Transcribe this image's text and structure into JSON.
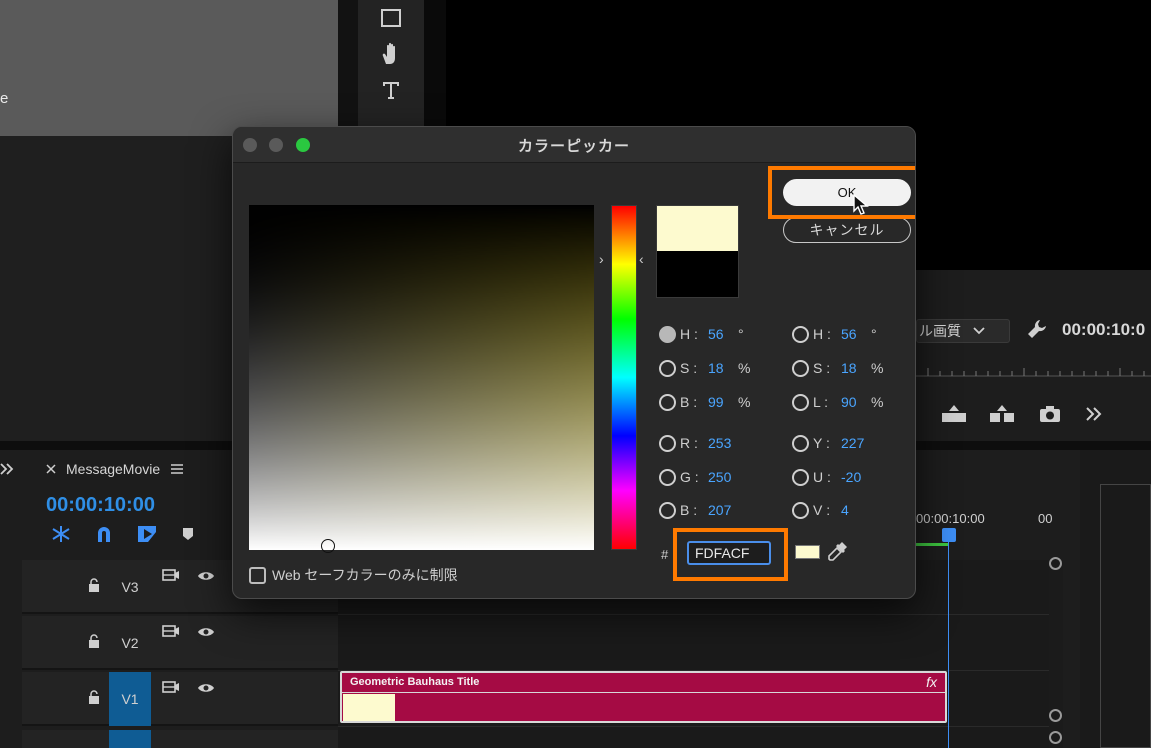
{
  "background_app": {
    "left_panel_text": "e",
    "program_monitor": {
      "quality_value": "ル画質",
      "timecode": "00:00:10:0"
    },
    "timeline": {
      "sequence_name": "MessageMovie",
      "timecode": "00:00:10:00",
      "ruler_labels": [
        "00:00:10:00",
        "00"
      ],
      "tracks": [
        {
          "name": "V3"
        },
        {
          "name": "V2"
        },
        {
          "name": "V1"
        }
      ],
      "clip": {
        "title": "Geometric Bauhaus Title",
        "fx": "fx",
        "color": "#a50b44"
      }
    }
  },
  "dialog": {
    "title": "カラーピッカー",
    "ok_label": "OK",
    "cancel_label": "キャンセル",
    "current_color": "#FDFACF",
    "original_color": "#000000",
    "fields_left": [
      {
        "label": "H :",
        "value": "56",
        "unit": "°",
        "selected": true
      },
      {
        "label": "S :",
        "value": "18",
        "unit": "%",
        "selected": false
      },
      {
        "label": "B :",
        "value": "99",
        "unit": "%",
        "selected": false
      },
      {
        "label": "R :",
        "value": "253",
        "unit": "",
        "selected": false
      },
      {
        "label": "G :",
        "value": "250",
        "unit": "",
        "selected": false
      },
      {
        "label": "B :",
        "value": "207",
        "unit": "",
        "selected": false
      }
    ],
    "fields_right": [
      {
        "label": "H :",
        "value": "56",
        "unit": "°"
      },
      {
        "label": "S :",
        "value": "18",
        "unit": "%"
      },
      {
        "label": "L :",
        "value": "90",
        "unit": "%"
      },
      {
        "label": "Y :",
        "value": "227",
        "unit": ""
      },
      {
        "label": "U :",
        "value": "-20",
        "unit": ""
      },
      {
        "label": "V :",
        "value": "4",
        "unit": ""
      }
    ],
    "hex_prefix": "#",
    "hex_value": "FDFACF",
    "websafe_label": "Web セーフカラーのみに制限",
    "highlight_color": "#ff7a00"
  }
}
